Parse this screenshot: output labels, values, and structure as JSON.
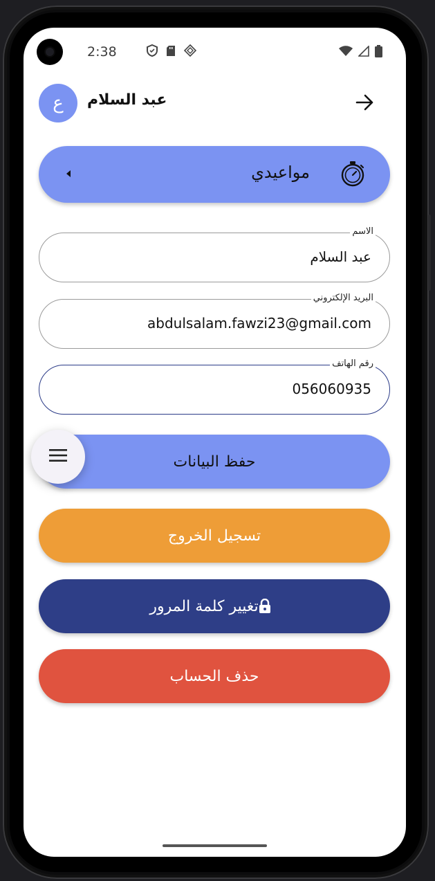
{
  "status_bar": {
    "time": "2:38",
    "left_icons": [
      "shield-icon",
      "sd-card-icon",
      "diamond-grid-icon"
    ],
    "right_icons": [
      "wifi-icon",
      "signal-icon",
      "battery-icon"
    ]
  },
  "header": {
    "avatar_letter": "ع",
    "user_name": "عبد السلام",
    "nav_icon": "arrow-right-icon"
  },
  "appointments": {
    "label": "مواعيدي",
    "icon": "timer-icon"
  },
  "form": {
    "name": {
      "label": "الاسم",
      "value": "عبد السلام"
    },
    "email": {
      "label": "البريد الإلكتروني",
      "value": "abdulsalam.fawzi23@gmail.com"
    },
    "phone": {
      "label": "رقم الهاتف",
      "value": "056060935"
    }
  },
  "buttons": {
    "save": "حفظ البيانات",
    "logout": "تسجيل الخروج",
    "change_password": "تغيير كلمة المرور",
    "delete_account": "حذف الحساب"
  },
  "colors": {
    "primary": "#7b93f2",
    "logout": "#ee9d37",
    "password": "#2e3e87",
    "delete": "#e0533f"
  }
}
